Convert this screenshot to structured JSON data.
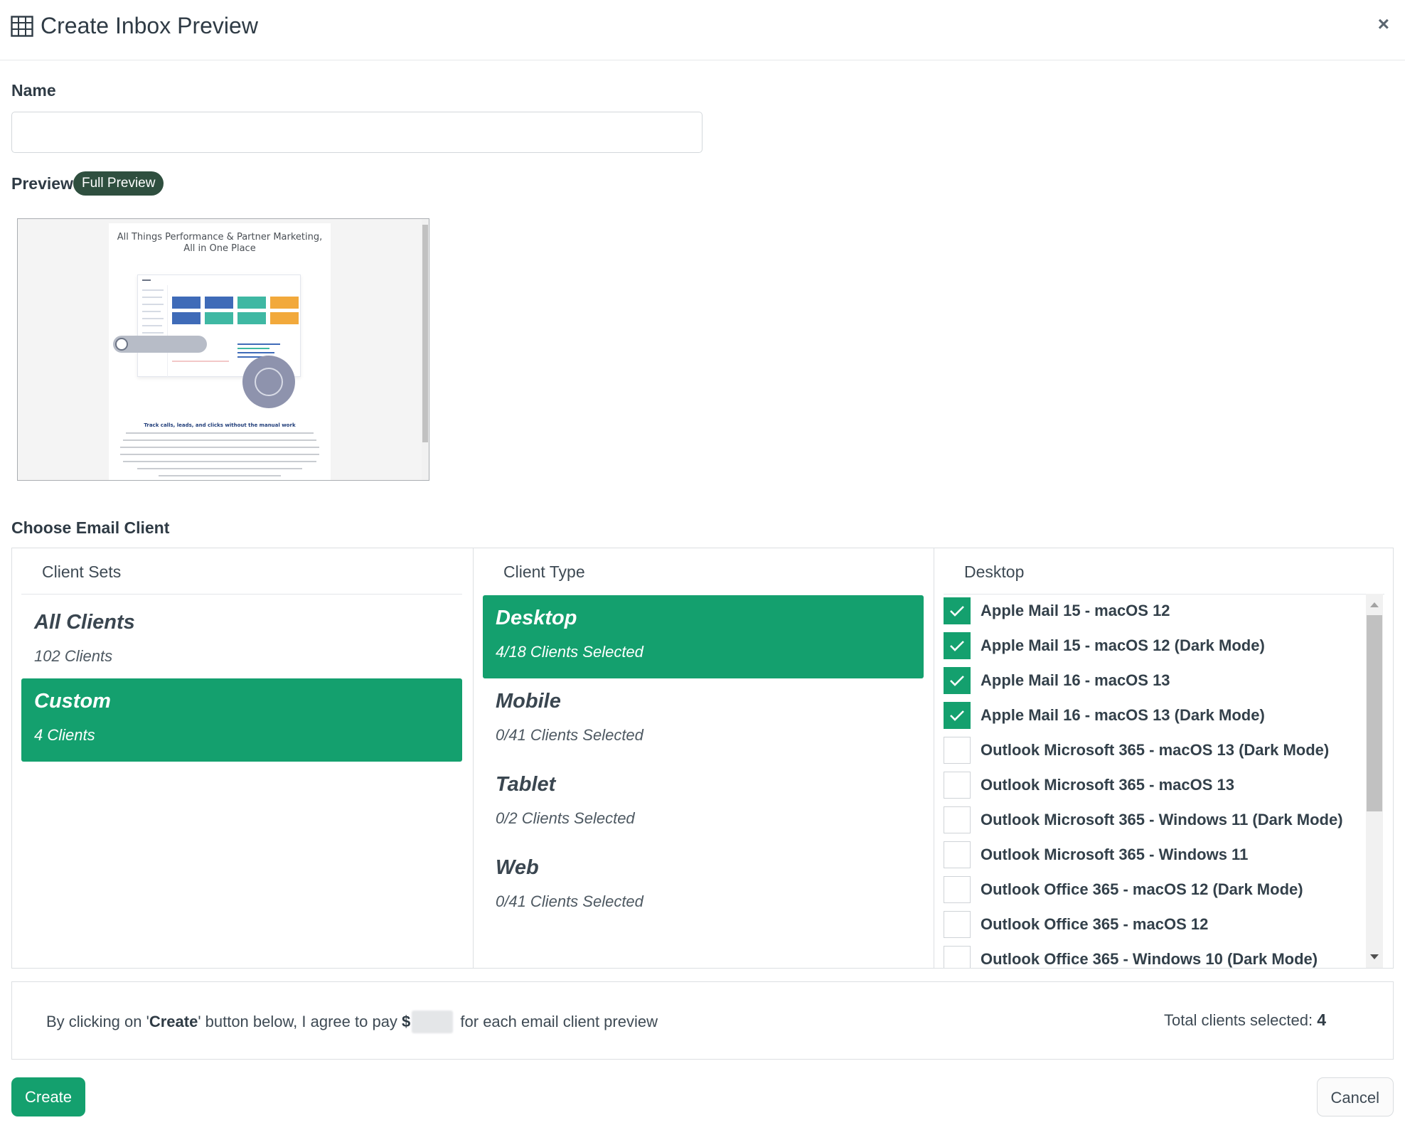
{
  "dialog": {
    "title": "Create Inbox Preview",
    "close_label": "×"
  },
  "name_field": {
    "label": "Name",
    "value": "",
    "placeholder": ""
  },
  "preview": {
    "label": "Preview",
    "badge": "Full Preview",
    "email_headline_1": "All Things Performance & Partner Marketing,",
    "email_headline_2": "All in One Place",
    "email_subhead": "Track calls, leads, and clicks without the manual work"
  },
  "client_chooser": {
    "label": "Choose Email Client",
    "client_sets": {
      "header": "Client Sets",
      "items": [
        {
          "title": "All Clients",
          "subtitle": "102 Clients",
          "active": false
        },
        {
          "title": "Custom",
          "subtitle": "4 Clients",
          "active": true
        }
      ]
    },
    "client_type": {
      "header": "Client Type",
      "items": [
        {
          "title": "Desktop",
          "subtitle": "4/18 Clients Selected",
          "active": true
        },
        {
          "title": "Mobile",
          "subtitle": "0/41 Clients Selected",
          "active": false
        },
        {
          "title": "Tablet",
          "subtitle": "0/2 Clients Selected",
          "active": false
        },
        {
          "title": "Web",
          "subtitle": "0/41 Clients Selected",
          "active": false
        }
      ]
    },
    "desktop": {
      "header": "Desktop",
      "items": [
        {
          "label": "Apple Mail 15 - macOS 12",
          "checked": true
        },
        {
          "label": "Apple Mail 15 - macOS 12 (Dark Mode)",
          "checked": true
        },
        {
          "label": "Apple Mail 16 - macOS 13",
          "checked": true
        },
        {
          "label": "Apple Mail 16 - macOS 13 (Dark Mode)",
          "checked": true
        },
        {
          "label": "Outlook Microsoft 365 - macOS 13 (Dark Mode)",
          "checked": false
        },
        {
          "label": "Outlook Microsoft 365 - macOS 13",
          "checked": false
        },
        {
          "label": "Outlook Microsoft 365 - Windows 11 (Dark Mode)",
          "checked": false
        },
        {
          "label": "Outlook Microsoft 365 - Windows 11",
          "checked": false
        },
        {
          "label": "Outlook Office 365 - macOS 12 (Dark Mode)",
          "checked": false
        },
        {
          "label": "Outlook Office 365 - macOS 12",
          "checked": false
        },
        {
          "label": "Outlook Office 365 - Windows 10 (Dark Mode)",
          "checked": false
        }
      ]
    }
  },
  "summary": {
    "agree_prefix": "By clicking on '",
    "agree_button_ref": "Create",
    "agree_middle": "' button below, I agree to pay ",
    "currency": "$",
    "agree_suffix": " for each email client preview",
    "total_label": "Total clients selected:",
    "total_value": "4"
  },
  "actions": {
    "create_label": "Create",
    "cancel_label": "Cancel"
  },
  "colors": {
    "accent": "#14a06e",
    "badge": "#2f4f3f",
    "text": "#2f3b45"
  }
}
